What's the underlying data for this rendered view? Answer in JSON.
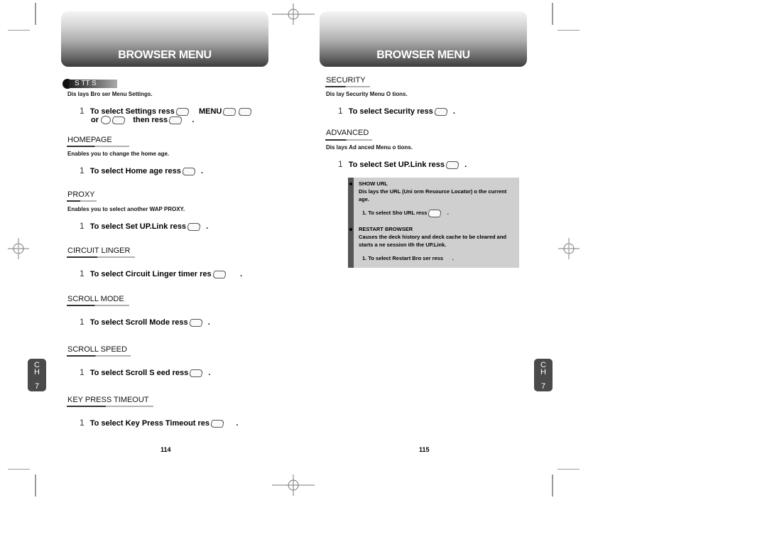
{
  "left_page": {
    "header_title": "BROWSER MENU",
    "settings_badge": "S  TT    S",
    "settings_desc": "Dis  lays Bro   ser Menu Settings.",
    "settings_step": {
      "num": "1",
      "line1": "To select Settings    ress",
      "menu": "MENU",
      "line2_a": "or",
      "line2_b": "then   re",
      "line2_c": "ss",
      "end": "."
    },
    "sections": [
      {
        "title": "HOMEPAGE",
        "desc": "Enables you to change the home  age.",
        "step_num": "1",
        "step": "To select Home  age    ress",
        "end": "."
      },
      {
        "title": "PROXY",
        "desc": "Enables you to select another WAP PROXY.",
        "step_num": "1",
        "step": "To select Set UP.Link    ress",
        "end": "."
      },
      {
        "title": "CIRCUIT LINGER",
        "desc": "",
        "step_num": "1",
        "step": "To select Circuit Linger timer    res",
        "end": "."
      },
      {
        "title": "SCROLL MODE",
        "desc": "",
        "step_num": "1",
        "step": "To select Scroll Mode    ress",
        "end": "."
      },
      {
        "title": "SCROLL SPEED",
        "desc": "",
        "step_num": "1",
        "step": "To select Scroll S  eed    ress",
        "end": "."
      },
      {
        "title": "KEY PRESS TIMEOUT",
        "desc": "",
        "step_num": "1",
        "step": "To select Key Press Timeout    res",
        "end": "."
      }
    ],
    "chapter_tab": {
      "line1": "C",
      "line2": "H",
      "num": "7"
    },
    "page_number": "114"
  },
  "right_page": {
    "header_title": "BROWSER MENU",
    "sections": [
      {
        "title": "SECURITY",
        "desc": "Dis  lay Security Menu O  tions.",
        "step_num": "1",
        "step": "To select Security    ress",
        "end": "."
      },
      {
        "title": "ADVANCED",
        "desc": "Dis  lays Ad  anced Menu o  tions.",
        "step_num": "1",
        "step": "To select Set UP.Link    ress",
        "end": "."
      }
    ],
    "note": {
      "items": [
        {
          "title": "SHOW URL",
          "body": "Dis  lays the URL (Uni  orm Resource Locator) o  the current   age.",
          "step": "1. To select Sho    URL    re",
          "step_key": "ss",
          "end": "."
        },
        {
          "title": "RESTART BROWSER",
          "body": "Causes the deck history and deck cache to be cleared and starts a ne   session   ith the UP.Link.",
          "step": "1. To select Restart Bro   ser    re",
          "step_key": "ss",
          "end": "."
        }
      ]
    },
    "chapter_tab": {
      "line1": "C",
      "line2": "H",
      "num": "7"
    },
    "page_number": "115"
  }
}
